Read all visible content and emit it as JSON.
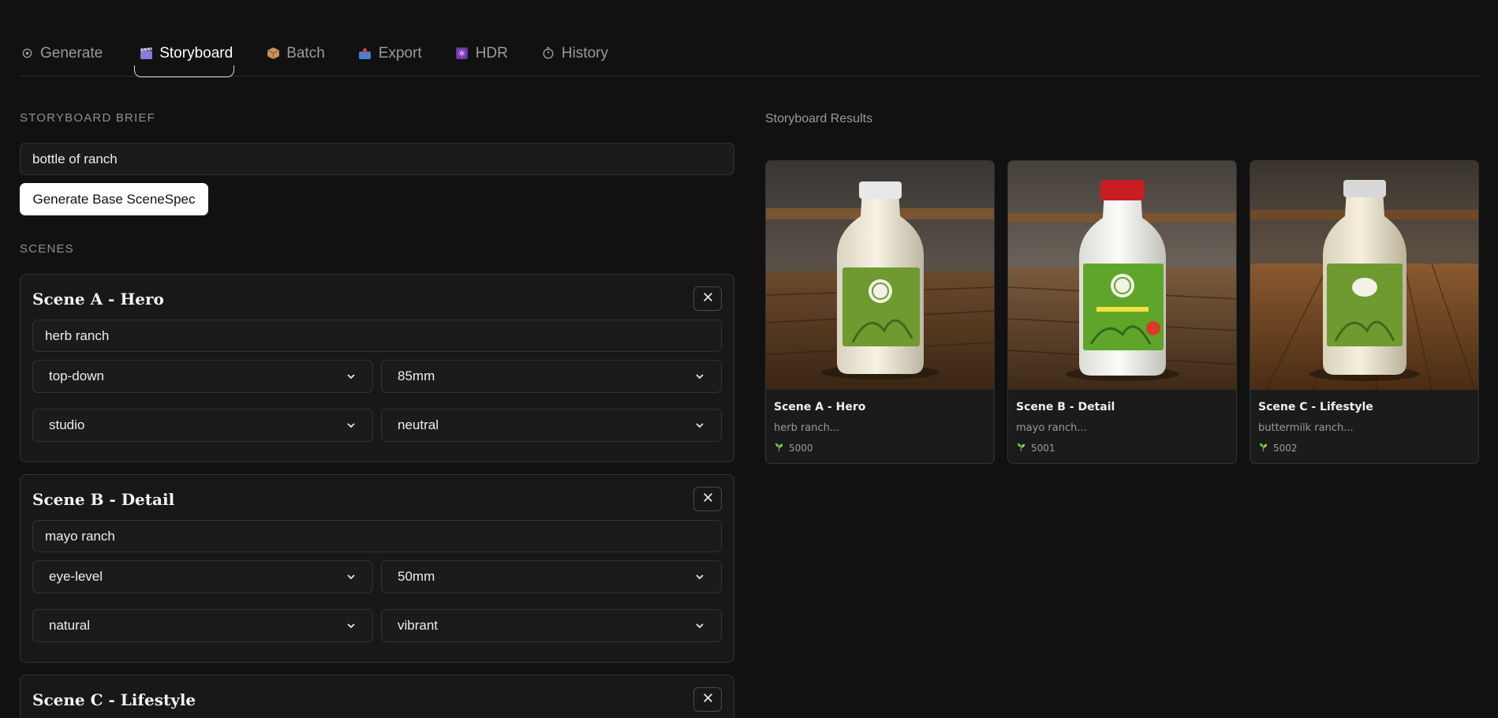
{
  "tabs": [
    {
      "label": "Generate",
      "icon": "gear-icon"
    },
    {
      "label": "Storyboard",
      "icon": "clapperboard-icon"
    },
    {
      "label": "Batch",
      "icon": "package-icon"
    },
    {
      "label": "Export",
      "icon": "outbox-icon"
    },
    {
      "label": "HDR",
      "icon": "sparkle-grid-icon"
    },
    {
      "label": "History",
      "icon": "stopwatch-icon"
    }
  ],
  "active_tab": "Storyboard",
  "brief": {
    "label": "STORYBOARD BRIEF",
    "value": "bottle of ranch",
    "generate_button": "Generate Base SceneSpec"
  },
  "scenes_label": "SCENES",
  "scenes": [
    {
      "title": "Scene A - Hero",
      "prompt": "herb ranch",
      "angle": "top-down",
      "lens": "85mm",
      "lighting": "studio",
      "grade": "neutral"
    },
    {
      "title": "Scene B - Detail",
      "prompt": "mayo ranch",
      "angle": "eye-level",
      "lens": "50mm",
      "lighting": "natural",
      "grade": "vibrant"
    },
    {
      "title": "Scene C - Lifestyle"
    }
  ],
  "results": {
    "label": "Storyboard Results",
    "items": [
      {
        "title": "Scene A - Hero",
        "desc": "herb ranch...",
        "seed": "5000",
        "cap_color": "#e8e8e8"
      },
      {
        "title": "Scene B - Detail",
        "desc": "mayo ranch...",
        "seed": "5001",
        "cap_color": "#c81e23"
      },
      {
        "title": "Scene C - Lifestyle",
        "desc": "buttermilk ranch...",
        "seed": "5002",
        "cap_color": "#d8d8d8"
      }
    ]
  },
  "colors": {
    "background": "#111111",
    "card": "#181818",
    "border": "#333333",
    "label_green": "#6f9a2f",
    "accent_white": "#ffffff"
  }
}
